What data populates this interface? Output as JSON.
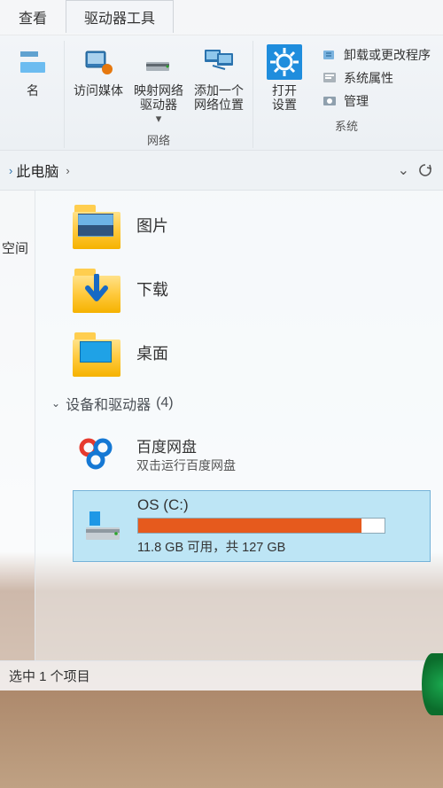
{
  "tabs": {
    "view": "查看",
    "tools": "驱动器工具"
  },
  "ribbon": {
    "big": {
      "rename": "名",
      "media": "访问媒体",
      "map_drive": "映射网络\n驱动器",
      "add_location": "添加一个\n网络位置",
      "open_settings": "打开\n设置"
    },
    "small": {
      "uninstall": "卸载或更改程序",
      "sys_props": "系统属性",
      "manage": "管理"
    },
    "groups": {
      "network": "网络",
      "system": "系统"
    }
  },
  "breadcrumb": {
    "this_pc": "此电脑"
  },
  "sidebar": {
    "fragment_space": "空间"
  },
  "folders": {
    "pictures": "图片",
    "downloads": "下载",
    "desktop": "桌面"
  },
  "section": {
    "devices_header": "设备和驱动器",
    "devices_count": "(4)"
  },
  "baidu": {
    "name": "百度网盘",
    "hint": "双击运行百度网盘"
  },
  "disk": {
    "name": "OS (C:)",
    "status_line": "11.8 GB 可用，共 127 GB",
    "free_gb": 11.8,
    "total_gb": 127,
    "fill_percent": 90.7
  },
  "status": {
    "selection": "选中 1 个项目"
  }
}
